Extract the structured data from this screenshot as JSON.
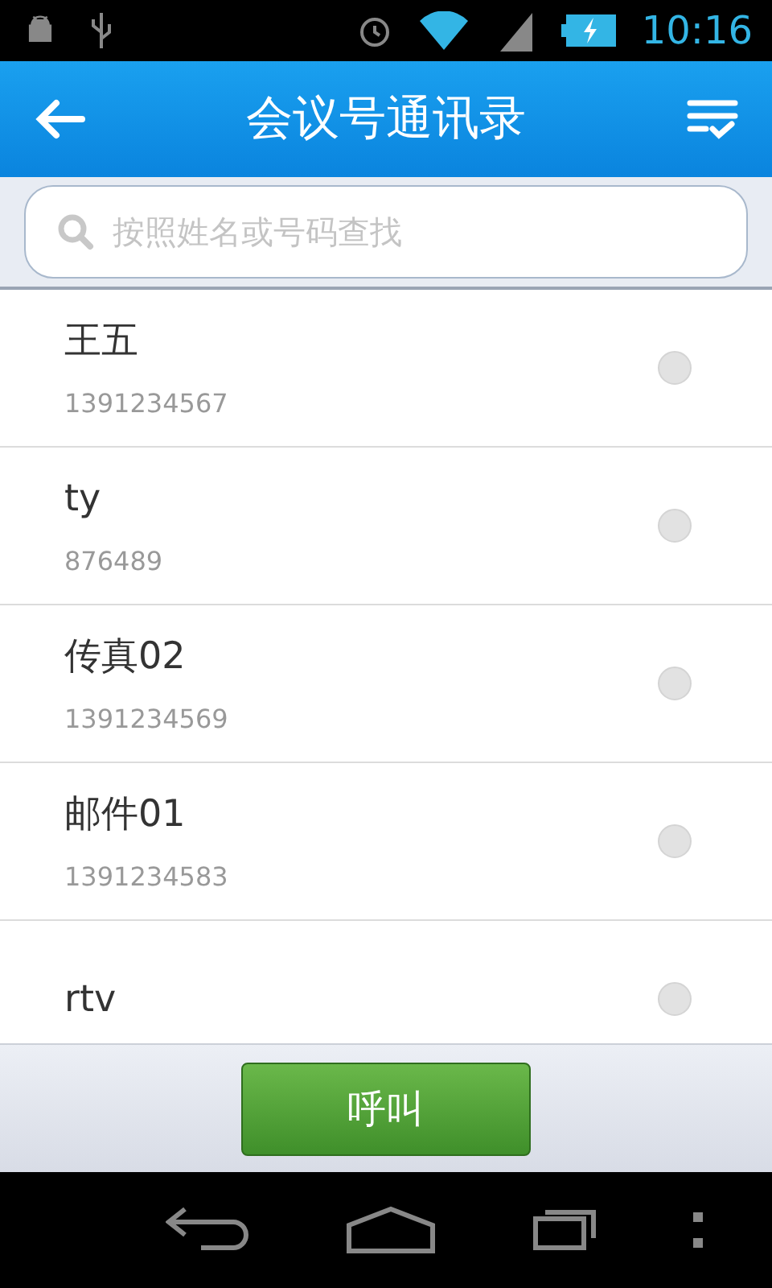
{
  "status_bar": {
    "time": "10:16"
  },
  "header": {
    "title": "会议号通讯录"
  },
  "search": {
    "placeholder": "按照姓名或号码查找"
  },
  "contacts": [
    {
      "name": "王五",
      "phone": "1391234567",
      "selected": false
    },
    {
      "name": "ty",
      "phone": "876489",
      "selected": false
    },
    {
      "name": "传真02",
      "phone": "1391234569",
      "selected": false
    },
    {
      "name": "邮件01",
      "phone": "1391234583",
      "selected": false
    },
    {
      "name": "rtv",
      "selected": false
    }
  ],
  "call_button": {
    "label": "呼叫"
  }
}
